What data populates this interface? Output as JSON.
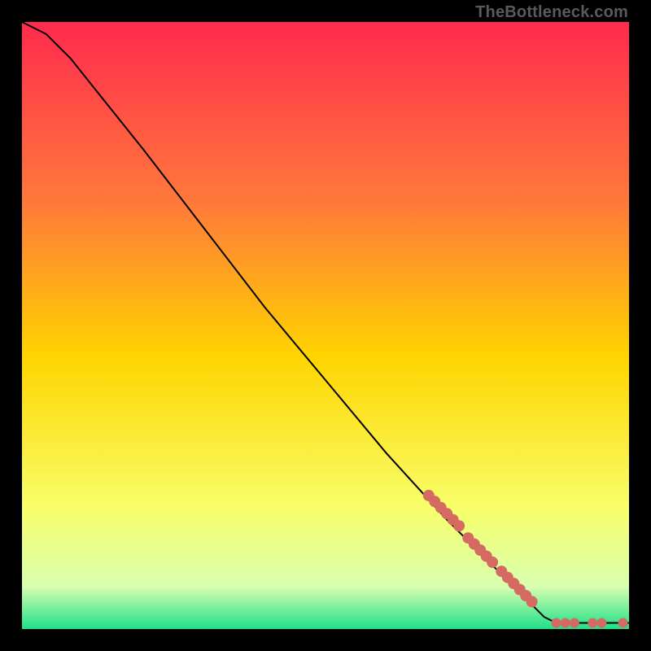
{
  "watermark": "TheBottleneck.com",
  "colors": {
    "gradient_top": "#ff2a4e",
    "gradient_mid_upper": "#ff7a3a",
    "gradient_mid": "#ffd400",
    "gradient_mid_lower": "#f8ff6a",
    "gradient_lower": "#d8ffb0",
    "gradient_bottom": "#1fe08a",
    "curve": "#000000",
    "markers": "#d46a62"
  },
  "chart_data": {
    "type": "line",
    "title": "",
    "xlabel": "",
    "ylabel": "",
    "xlim": [
      0,
      100
    ],
    "ylim": [
      0,
      100
    ],
    "curve": [
      {
        "x": 0,
        "y": 100
      },
      {
        "x": 4,
        "y": 98
      },
      {
        "x": 8,
        "y": 94
      },
      {
        "x": 12,
        "y": 89
      },
      {
        "x": 20,
        "y": 79
      },
      {
        "x": 30,
        "y": 66
      },
      {
        "x": 40,
        "y": 53
      },
      {
        "x": 50,
        "y": 41
      },
      {
        "x": 60,
        "y": 29
      },
      {
        "x": 70,
        "y": 18
      },
      {
        "x": 80,
        "y": 8
      },
      {
        "x": 86,
        "y": 2
      },
      {
        "x": 88,
        "y": 1
      },
      {
        "x": 90,
        "y": 1
      },
      {
        "x": 100,
        "y": 1
      }
    ],
    "markers_on_slope": [
      {
        "x": 67,
        "y": 22
      },
      {
        "x": 68,
        "y": 21
      },
      {
        "x": 69,
        "y": 20
      },
      {
        "x": 70,
        "y": 19
      },
      {
        "x": 71,
        "y": 18
      },
      {
        "x": 72,
        "y": 17
      },
      {
        "x": 73.5,
        "y": 15
      },
      {
        "x": 74.5,
        "y": 14
      },
      {
        "x": 75.5,
        "y": 13
      },
      {
        "x": 76.5,
        "y": 12
      },
      {
        "x": 77.5,
        "y": 11
      },
      {
        "x": 79,
        "y": 9.5
      },
      {
        "x": 80,
        "y": 8.5
      },
      {
        "x": 81,
        "y": 7.5
      },
      {
        "x": 82,
        "y": 6.5
      },
      {
        "x": 83,
        "y": 5.5
      },
      {
        "x": 84,
        "y": 4.5
      }
    ],
    "markers_on_flat": [
      {
        "x": 88,
        "y": 1
      },
      {
        "x": 89.5,
        "y": 1
      },
      {
        "x": 91,
        "y": 1
      },
      {
        "x": 94,
        "y": 1
      },
      {
        "x": 95.5,
        "y": 1
      },
      {
        "x": 99,
        "y": 1
      }
    ]
  }
}
